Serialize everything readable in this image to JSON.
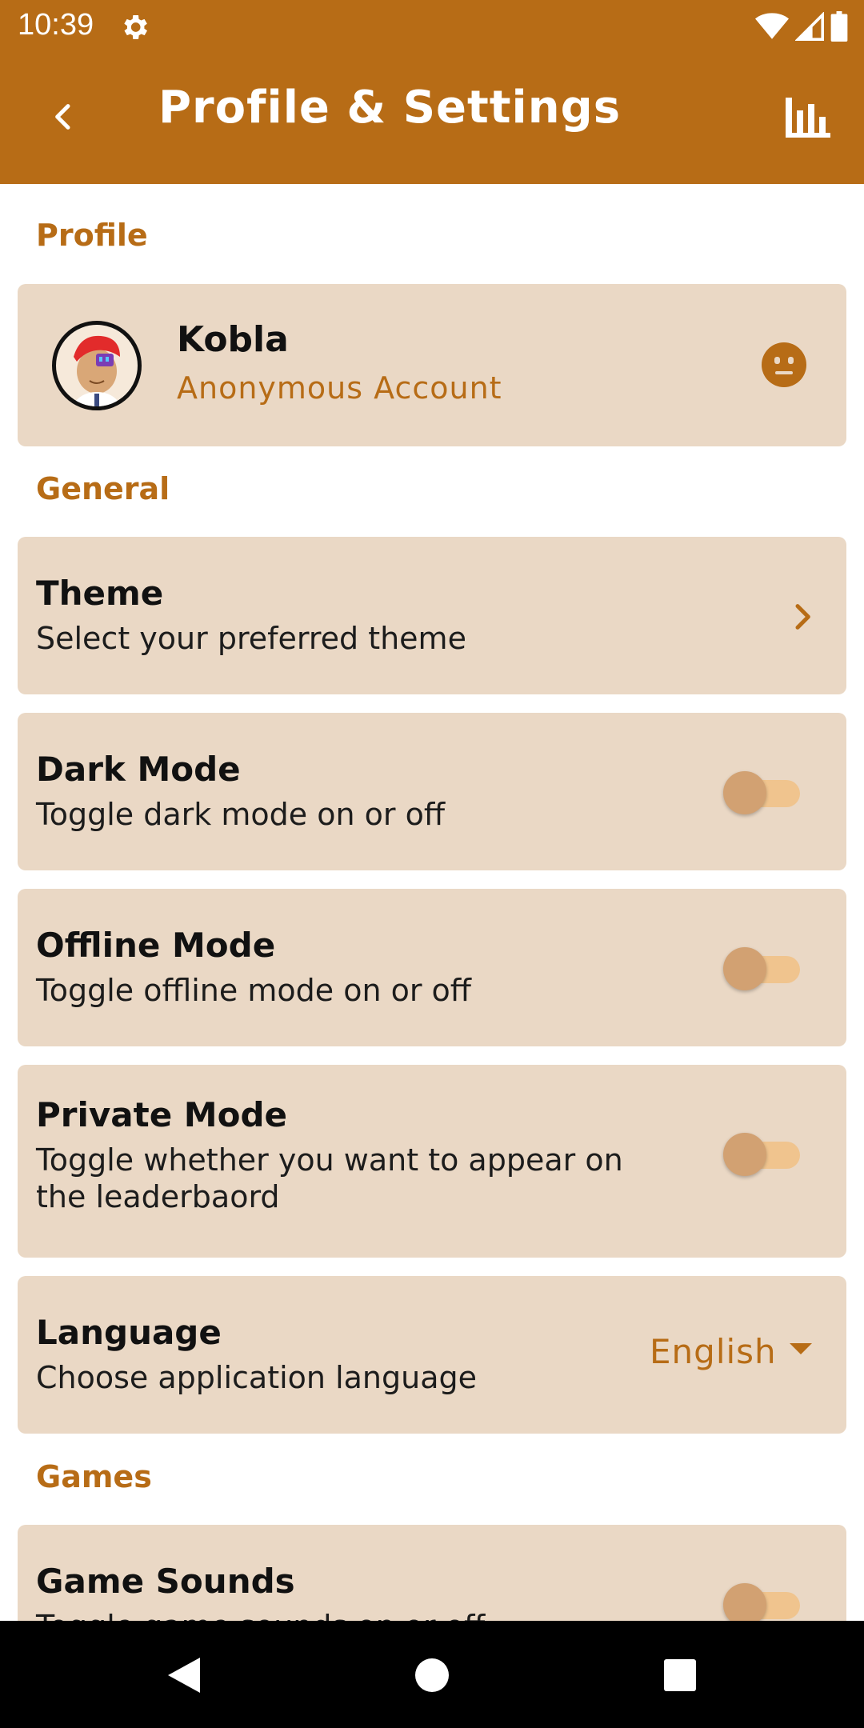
{
  "status_bar": {
    "time": "10:39",
    "settings_icon": "gear-icon",
    "wifi_icon": "wifi-icon",
    "signal_icon": "signal-icon",
    "battery_icon": "battery-icon"
  },
  "app_bar": {
    "title": "Profile & Settings",
    "back_icon": "chevron-left-icon",
    "leaderboard_icon": "bar-chart-icon"
  },
  "sections": {
    "profile": "Profile",
    "general": "General",
    "games": "Games"
  },
  "profile": {
    "name": "Kobla",
    "account_type": "Anonymous Account",
    "status_icon": "neutral-face-icon"
  },
  "general": {
    "theme": {
      "title": "Theme",
      "subtitle": "Select your preferred theme"
    },
    "dark_mode": {
      "title": "Dark Mode",
      "subtitle": "Toggle dark mode on or off",
      "enabled": false
    },
    "offline_mode": {
      "title": "Offline Mode",
      "subtitle": "Toggle offline mode on or off",
      "enabled": false
    },
    "private_mode": {
      "title": "Private Mode",
      "subtitle": "Toggle whether you want to appear on the leaderbaord",
      "enabled": false
    },
    "language": {
      "title": "Language",
      "subtitle": "Choose application language",
      "selected": "English"
    }
  },
  "games": {
    "game_sounds": {
      "title": "Game Sounds",
      "subtitle": "Toggle game sounds on or off",
      "enabled": false
    }
  },
  "colors": {
    "primary": "#b76c16",
    "card_bg": "#ead8c5",
    "toggle_track": "#f0c48e",
    "toggle_thumb": "#d2a172"
  }
}
